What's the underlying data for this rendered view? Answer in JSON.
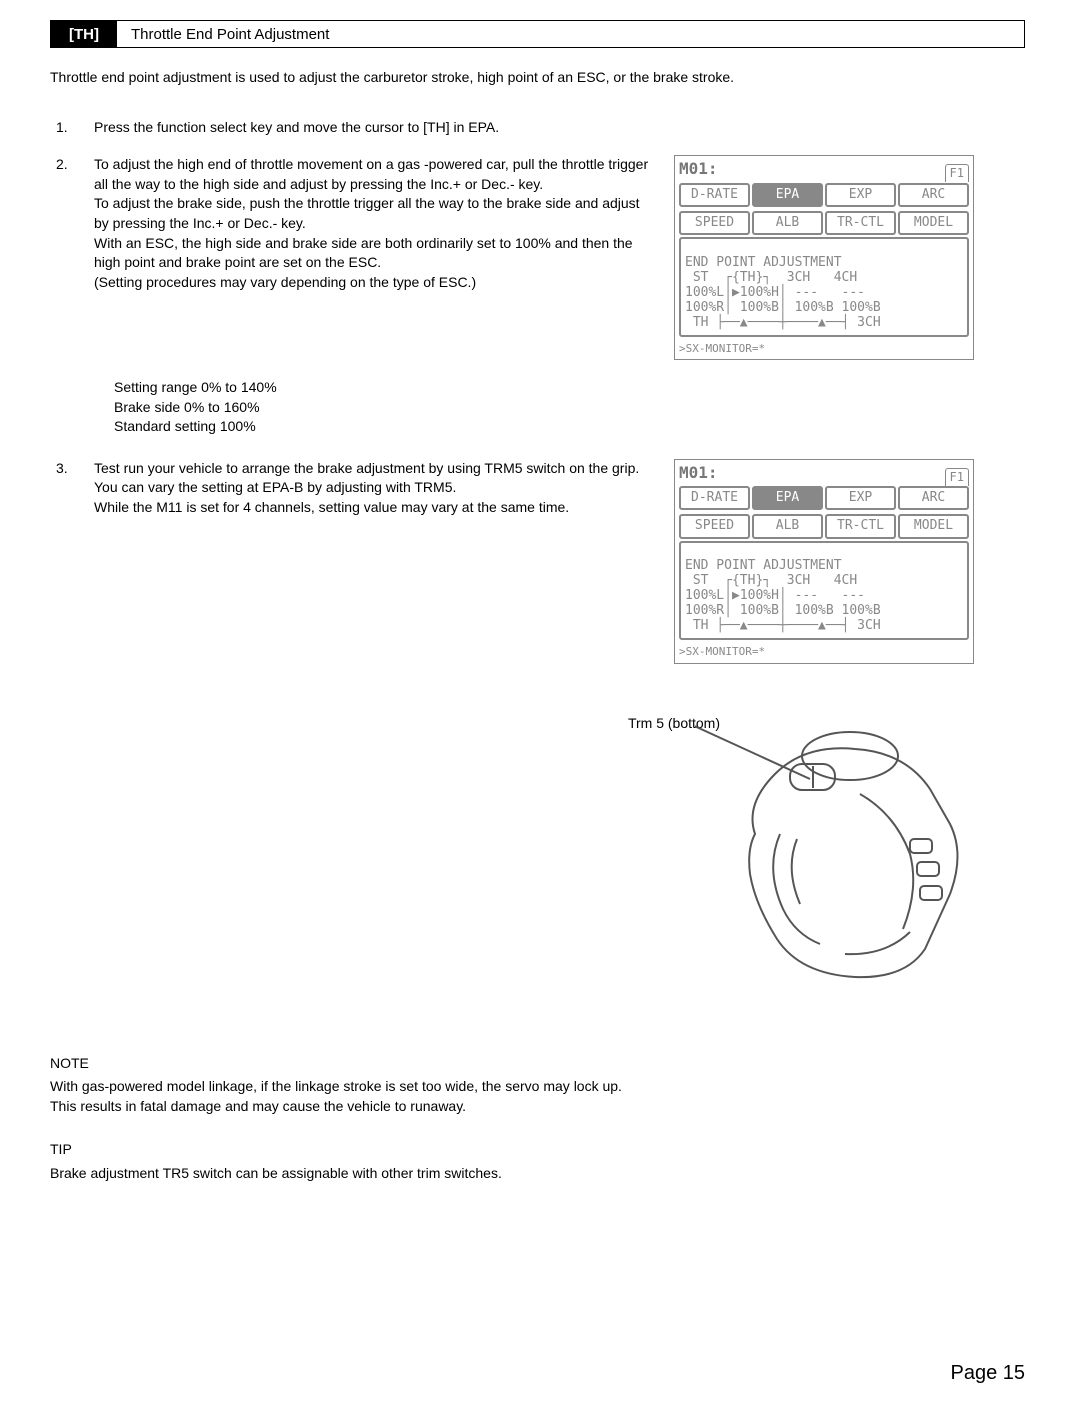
{
  "header": {
    "tag": "[TH]",
    "title": "Throttle End Point Adjustment"
  },
  "intro": "Throttle end point adjustment is used to adjust the carburetor stroke, high point of an ESC, or the brake stroke.",
  "steps": [
    {
      "n": "1.",
      "body": [
        "Press the function select key and move the cursor to [TH] in EPA."
      ]
    },
    {
      "n": "2.",
      "body": [
        "To adjust the high end of throttle movement on a gas -powered car, pull the throttle trigger all the way to the high side and adjust by pressing the Inc.+ or Dec.- key.",
        "To adjust the brake side, push the throttle trigger all the way to the brake side and adjust by pressing the Inc.+ or Dec.- key.",
        "With an ESC, the high side and brake side are both ordinarily set to 100% and then the high point and brake point are set on the ESC.",
        "(Setting procedures may vary depending on the type of ESC.)"
      ]
    },
    {
      "n": "3.",
      "body": [
        "Test run your vehicle to arrange the brake adjustment by using TRM5 switch on the grip. You can vary the setting at EPA-B by adjusting with TRM5.",
        "While the M11 is set for 4 channels, setting value may vary at the same time."
      ]
    }
  ],
  "settings": [
    "Setting range 0% to 140%",
    "Brake side 0% to 160%",
    "Standard setting 100%"
  ],
  "lcd": {
    "model": "M01:",
    "f1": "F1",
    "tabs_row1": [
      "D-RATE",
      "EPA",
      "EXP",
      "ARC"
    ],
    "tabs_row2": [
      "SPEED",
      "ALB",
      "TR-CTL",
      "MODEL"
    ],
    "body_title": "END POINT ADJUSTMENT",
    "line1": " ST  ┌{TH}┐  3CH   4CH",
    "line2a": "100%L│▶100%H│ ---   ---",
    "line2b": "100%L│▶100%H│ ---   ---",
    "line3": "100%R│ 100%B│ 100%B 100%B",
    "th_line": " TH ├──▲────┼────▲──┤ 3CH",
    "footer": ">SX-MONITOR=*"
  },
  "trm_label": "Trm 5 (bottom)",
  "note_head": "NOTE",
  "note_body": "With gas-powered model linkage, if the linkage stroke is set too wide, the servo may lock up.  This results in fatal damage and may cause the vehicle to runaway.",
  "tip_head": "TIP",
  "tip_body": "Brake adjustment TR5 switch can be assignable with other trim switches.",
  "page": "Page 15"
}
